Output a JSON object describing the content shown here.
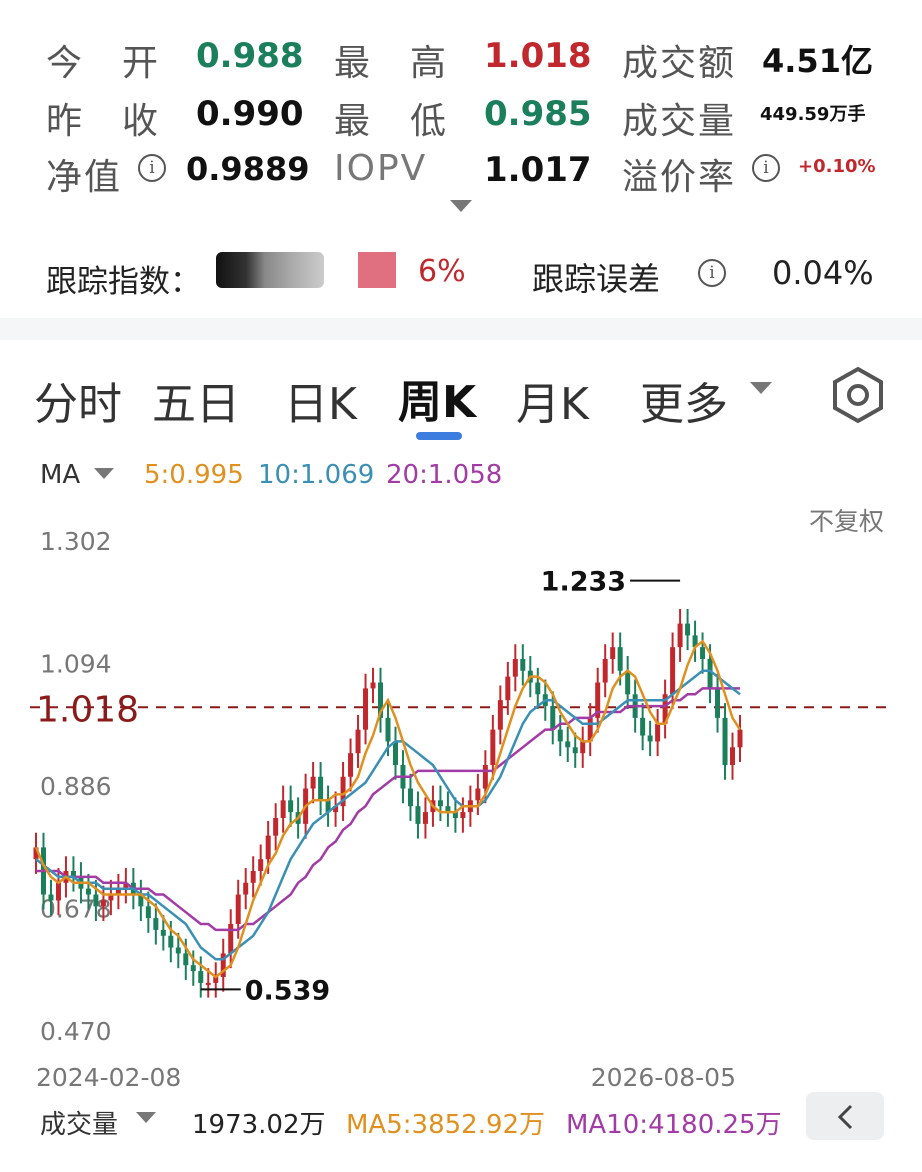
{
  "quote": {
    "open": {
      "label": "今　开",
      "value": "0.988"
    },
    "high": {
      "label": "最　高",
      "value": "1.018"
    },
    "turnover": {
      "label": "成交额",
      "value": "4.51亿"
    },
    "prev_close": {
      "label": "昨　收",
      "value": "0.990"
    },
    "low": {
      "label": "最　低",
      "value": "0.985"
    },
    "volume": {
      "label": "成交量",
      "value": "449.59万手"
    },
    "nav": {
      "label": "净值",
      "value": "0.9889"
    },
    "iopv": {
      "label": "IOPV",
      "value": "1.017"
    },
    "premium": {
      "label": "溢价率",
      "value": "+0.10%"
    }
  },
  "tracking": {
    "index_label": "跟踪指数：",
    "index_pct": "6%",
    "error_label": "跟踪误差",
    "error_value": "0.04%"
  },
  "tabs": [
    {
      "label": "分时",
      "active": false
    },
    {
      "label": "五日",
      "active": false
    },
    {
      "label": "日K",
      "active": false
    },
    {
      "label": "周K",
      "active": true
    },
    {
      "label": "月K",
      "active": false
    },
    {
      "label": "更多",
      "active": false
    }
  ],
  "icons": {
    "settings": "hexagon-gear-icon",
    "dropdown": "triangle-down-icon",
    "info": "info-icon",
    "back": "chevron-left-icon"
  },
  "colors": {
    "up": "#c0282d",
    "down": "#1a7f5a",
    "ma5": "#e0901e",
    "ma10": "#3a8fb5",
    "ma20": "#a23ba5",
    "current_line": "#8b1a1a",
    "accent": "#3d7de0"
  },
  "ma_legend": {
    "label": "MA",
    "ma5": "5:0.995",
    "ma10": "10:1.069",
    "ma20": "20:1.058"
  },
  "chart_data": {
    "type": "candlestick",
    "y_ticks": [
      "1.302",
      "1.094",
      "0.886",
      "0.678",
      "0.470"
    ],
    "ylim": [
      0.47,
      1.302
    ],
    "current_price": "1.018",
    "adjust_label": "不复权",
    "high_marker": "1.233",
    "low_marker": "0.539",
    "x_start": "2024-02-08",
    "x_end": "2026-08-05",
    "closes": [
      0.78,
      0.7,
      0.69,
      0.72,
      0.74,
      0.73,
      0.71,
      0.7,
      0.68,
      0.69,
      0.7,
      0.71,
      0.72,
      0.7,
      0.68,
      0.66,
      0.64,
      0.63,
      0.61,
      0.6,
      0.58,
      0.57,
      0.55,
      0.55,
      0.56,
      0.6,
      0.65,
      0.7,
      0.72,
      0.74,
      0.76,
      0.8,
      0.83,
      0.86,
      0.84,
      0.82,
      0.88,
      0.9,
      0.86,
      0.84,
      0.85,
      0.9,
      0.94,
      0.98,
      1.05,
      1.06,
      1.0,
      0.96,
      0.92,
      0.88,
      0.85,
      0.82,
      0.84,
      0.86,
      0.85,
      0.84,
      0.83,
      0.84,
      0.86,
      0.88,
      0.92,
      0.98,
      1.03,
      1.07,
      1.1,
      1.08,
      1.06,
      1.04,
      1.02,
      0.98,
      0.96,
      0.95,
      0.94,
      0.96,
      1.0,
      1.06,
      1.1,
      1.12,
      1.08,
      1.04,
      1.0,
      0.97,
      0.96,
      0.99,
      1.04,
      1.12,
      1.16,
      1.14,
      1.12,
      1.1,
      1.05,
      1.0,
      0.92,
      0.95,
      0.98
    ],
    "ma5": [
      0.78,
      0.75,
      0.73,
      0.72,
      0.73,
      0.72,
      0.72,
      0.72,
      0.71,
      0.7,
      0.7,
      0.7,
      0.7,
      0.7,
      0.7,
      0.69,
      0.68,
      0.66,
      0.64,
      0.63,
      0.61,
      0.59,
      0.58,
      0.57,
      0.56,
      0.57,
      0.58,
      0.61,
      0.65,
      0.69,
      0.72,
      0.75,
      0.77,
      0.8,
      0.82,
      0.83,
      0.85,
      0.86,
      0.86,
      0.86,
      0.87,
      0.87,
      0.88,
      0.9,
      0.94,
      0.97,
      1.01,
      1.03,
      1.0,
      0.96,
      0.92,
      0.89,
      0.87,
      0.85,
      0.84,
      0.84,
      0.84,
      0.85,
      0.85,
      0.85,
      0.87,
      0.9,
      0.94,
      0.98,
      1.02,
      1.05,
      1.07,
      1.07,
      1.06,
      1.04,
      1.01,
      0.99,
      0.97,
      0.96,
      0.96,
      0.98,
      1.01,
      1.05,
      1.07,
      1.08,
      1.07,
      1.04,
      1.01,
      0.99,
      0.99,
      1.02,
      1.05,
      1.09,
      1.12,
      1.13,
      1.11,
      1.08,
      1.04,
      1.0,
      0.98
    ],
    "ma10": [
      0.76,
      0.75,
      0.74,
      0.73,
      0.73,
      0.73,
      0.72,
      0.72,
      0.72,
      0.71,
      0.71,
      0.71,
      0.71,
      0.71,
      0.7,
      0.7,
      0.69,
      0.68,
      0.67,
      0.66,
      0.65,
      0.63,
      0.61,
      0.6,
      0.59,
      0.59,
      0.6,
      0.61,
      0.62,
      0.63,
      0.65,
      0.67,
      0.7,
      0.73,
      0.76,
      0.78,
      0.8,
      0.82,
      0.83,
      0.84,
      0.85,
      0.86,
      0.87,
      0.88,
      0.89,
      0.91,
      0.93,
      0.95,
      0.96,
      0.96,
      0.95,
      0.94,
      0.93,
      0.92,
      0.9,
      0.88,
      0.86,
      0.85,
      0.85,
      0.85,
      0.86,
      0.88,
      0.9,
      0.93,
      0.96,
      0.99,
      1.01,
      1.02,
      1.03,
      1.03,
      1.02,
      1.01,
      1.0,
      0.99,
      0.99,
      0.99,
      1.0,
      1.01,
      1.02,
      1.03,
      1.03,
      1.03,
      1.03,
      1.03,
      1.03,
      1.04,
      1.05,
      1.06,
      1.07,
      1.08,
      1.08,
      1.07,
      1.06,
      1.05,
      1.04
    ],
    "ma20": [
      0.74,
      0.74,
      0.74,
      0.74,
      0.73,
      0.73,
      0.73,
      0.73,
      0.73,
      0.72,
      0.72,
      0.72,
      0.72,
      0.71,
      0.71,
      0.71,
      0.7,
      0.7,
      0.69,
      0.68,
      0.67,
      0.66,
      0.65,
      0.65,
      0.64,
      0.64,
      0.64,
      0.64,
      0.65,
      0.65,
      0.66,
      0.67,
      0.68,
      0.69,
      0.7,
      0.72,
      0.73,
      0.75,
      0.76,
      0.78,
      0.79,
      0.81,
      0.82,
      0.84,
      0.85,
      0.87,
      0.88,
      0.89,
      0.9,
      0.9,
      0.9,
      0.91,
      0.91,
      0.91,
      0.91,
      0.91,
      0.91,
      0.91,
      0.91,
      0.91,
      0.91,
      0.91,
      0.92,
      0.93,
      0.94,
      0.95,
      0.96,
      0.97,
      0.98,
      0.98,
      0.99,
      0.99,
      1.0,
      1.0,
      1.0,
      1.01,
      1.01,
      1.01,
      1.01,
      1.02,
      1.02,
      1.02,
      1.02,
      1.02,
      1.02,
      1.03,
      1.03,
      1.04,
      1.04,
      1.05,
      1.05,
      1.05,
      1.05,
      1.05,
      1.05
    ]
  },
  "volume_bar": {
    "label": "成交量",
    "value": "1973.02万",
    "ma5": "MA5:3852.92万",
    "ma10": "MA10:4180.25万"
  }
}
